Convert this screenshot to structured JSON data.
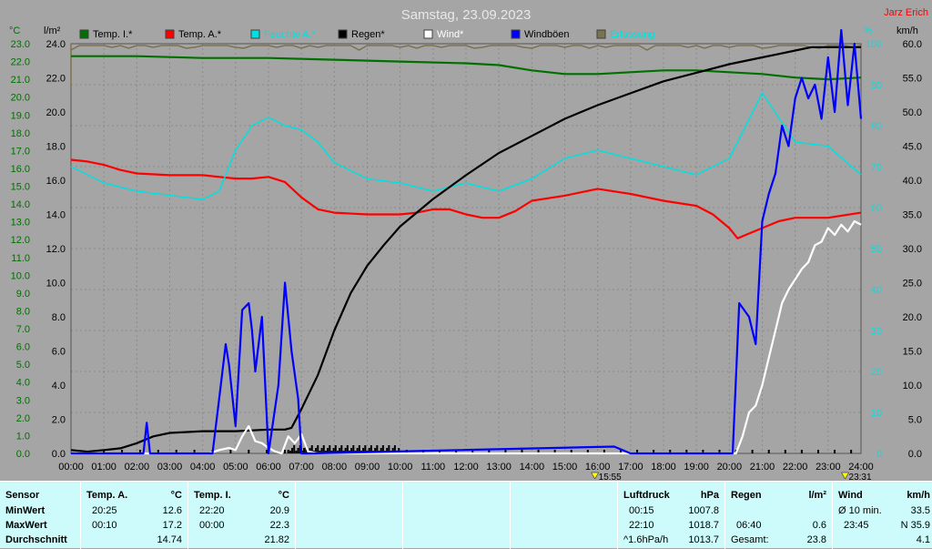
{
  "title": "Samstag, 23.09.2023",
  "author": "Jarz Erich",
  "units": {
    "temp": "°C",
    "rain": "l/m²",
    "hum": "%",
    "wind": "km/h"
  },
  "legend": [
    {
      "label": "Temp. I.*",
      "color": "#007000"
    },
    {
      "label": "Temp. A.*",
      "color": "#ff0000"
    },
    {
      "label": "Feuchte A.*",
      "color": "#00e0e0"
    },
    {
      "label": "Regen*",
      "color": "#000000"
    },
    {
      "label": "Wind*",
      "color": "#ffffff"
    },
    {
      "label": "Windböen",
      "color": "#0000ff"
    },
    {
      "label": "Erfassung",
      "color": "#7a7350"
    }
  ],
  "markers": {
    "left": "15:55",
    "right": "23:31"
  },
  "chart_data": {
    "type": "line",
    "x_ticks": [
      "00:00",
      "01:00",
      "02:00",
      "03:00",
      "04:00",
      "05:00",
      "06:00",
      "07:00",
      "08:00",
      "09:00",
      "10:00",
      "11:00",
      "12:00",
      "13:00",
      "14:00",
      "15:00",
      "16:00",
      "17:00",
      "18:00",
      "19:00",
      "20:00",
      "21:00",
      "22:00",
      "23:00",
      "24:00"
    ],
    "axes": {
      "temp_green": {
        "ticks": [
          "0.0",
          "1.0",
          "2.0",
          "3.0",
          "4.0",
          "5.0",
          "6.0",
          "7.0",
          "8.0",
          "9.0",
          "10.0",
          "11.0",
          "12.0",
          "13.0",
          "14.0",
          "15.0",
          "16.0",
          "17.0",
          "18.0",
          "19.0",
          "20.0",
          "21.0",
          "22.0",
          "23.0"
        ],
        "range": [
          0,
          23
        ]
      },
      "rain_black": {
        "ticks": [
          "0.0",
          "2.0",
          "4.0",
          "6.0",
          "8.0",
          "10.0",
          "12.0",
          "14.0",
          "16.0",
          "18.0",
          "20.0",
          "22.0",
          "24.0"
        ],
        "range": [
          0,
          24
        ]
      },
      "hum_cyan": {
        "ticks": [
          "0",
          "10",
          "20",
          "30",
          "40",
          "50",
          "60",
          "70",
          "80",
          "90",
          "100"
        ],
        "range": [
          0,
          100
        ]
      },
      "wind_black": {
        "ticks": [
          "0.0",
          "5.0",
          "10.0",
          "15.0",
          "20.0",
          "25.0",
          "30.0",
          "35.0",
          "40.0",
          "45.0",
          "50.0",
          "55.0",
          "60.0"
        ],
        "range": [
          0,
          60
        ]
      }
    },
    "series": [
      {
        "name": "Temp. I.*",
        "axis": "temp_green",
        "color": "#007000",
        "x": [
          0,
          2,
          4,
          6,
          8,
          10,
          12,
          13,
          14,
          15,
          16,
          17,
          18,
          19,
          20,
          21,
          22,
          23,
          24
        ],
        "y": [
          22.3,
          22.3,
          22.2,
          22.2,
          22.1,
          22.0,
          21.9,
          21.8,
          21.5,
          21.3,
          21.3,
          21.4,
          21.5,
          21.5,
          21.4,
          21.3,
          21.1,
          21.0,
          21.1
        ]
      },
      {
        "name": "Temp. A.*",
        "axis": "temp_red",
        "color": "#ff0000",
        "x": [
          0,
          0.5,
          1,
          1.5,
          2,
          3,
          4,
          4.5,
          5,
          5.5,
          6,
          6.5,
          7,
          7.5,
          8,
          9,
          10,
          10.5,
          11,
          11.5,
          12,
          12.5,
          13,
          13.5,
          14,
          15,
          16,
          17,
          18,
          19,
          19.5,
          20,
          20.25,
          20.5,
          21,
          21.5,
          22,
          23,
          24
        ],
        "y": [
          17.2,
          17.1,
          16.9,
          16.6,
          16.4,
          16.3,
          16.3,
          16.2,
          16.1,
          16.1,
          16.2,
          15.9,
          15.0,
          14.3,
          14.1,
          14.0,
          14.0,
          14.1,
          14.3,
          14.3,
          14.0,
          13.8,
          13.8,
          14.2,
          14.8,
          15.1,
          15.5,
          15.2,
          14.8,
          14.5,
          14.0,
          13.2,
          12.6,
          12.8,
          13.2,
          13.6,
          13.8,
          13.8,
          14.1
        ]
      },
      {
        "name": "Feuchte A.*",
        "axis": "hum_cyan",
        "color": "#00e0e0",
        "x": [
          0,
          1,
          2,
          3,
          4,
          4.5,
          5,
          5.5,
          6,
          6.5,
          7,
          7.5,
          8,
          9,
          10,
          11,
          12,
          13,
          14,
          15,
          16,
          17,
          18,
          19,
          20,
          20.5,
          21,
          21.5,
          22,
          23,
          24
        ],
        "y": [
          70,
          66,
          64,
          63,
          62,
          64,
          74,
          80,
          82,
          80,
          79,
          76,
          71,
          67,
          66,
          64,
          66,
          64,
          67,
          72,
          74,
          72,
          70,
          68,
          72,
          80,
          88,
          82,
          76,
          75,
          68
        ]
      },
      {
        "name": "Regen*",
        "axis": "rain_black",
        "color": "#000000",
        "x": [
          0,
          0.5,
          1,
          1.5,
          2,
          2.5,
          3,
          4,
          5,
          6,
          6.5,
          6.7,
          7,
          7.5,
          8,
          8.5,
          9,
          9.5,
          10,
          11,
          12,
          13,
          14,
          15,
          16,
          17,
          18,
          19,
          20,
          21,
          21.5,
          22,
          22.5,
          23,
          24
        ],
        "y": [
          0.2,
          0.1,
          0.2,
          0.3,
          0.6,
          1.0,
          1.2,
          1.3,
          1.3,
          1.4,
          1.4,
          1.5,
          2.6,
          4.6,
          7.2,
          9.4,
          11.0,
          12.2,
          13.3,
          14.9,
          16.3,
          17.6,
          18.6,
          19.6,
          20.4,
          21.1,
          21.8,
          22.3,
          22.8,
          23.2,
          23.4,
          23.6,
          23.8,
          23.8,
          23.8
        ]
      },
      {
        "name": "Wind*",
        "axis": "wind_black",
        "color": "#ffffff",
        "x": [
          0,
          4.2,
          4.5,
          4.8,
          5,
          5.2,
          5.4,
          5.6,
          5.8,
          6,
          6.2,
          6.4,
          6.6,
          6.8,
          7,
          7.2,
          7.5,
          20.2,
          20.4,
          20.6,
          20.8,
          21,
          21.2,
          21.4,
          21.6,
          21.8,
          22,
          22.2,
          22.4,
          22.6,
          22.8,
          23,
          23.2,
          23.4,
          23.6,
          23.8,
          24
        ],
        "y": [
          0,
          0,
          0.5,
          0.8,
          0.5,
          2.5,
          4.0,
          1.8,
          1.5,
          0.8,
          0.3,
          0,
          2.5,
          1.5,
          2.8,
          0.3,
          0,
          0,
          2.5,
          6,
          7,
          10,
          14,
          18,
          22,
          24,
          25.5,
          27,
          28,
          30.5,
          31,
          33,
          32,
          33.5,
          32.5,
          34,
          33.5
        ]
      },
      {
        "name": "Windböen",
        "axis": "wind_black",
        "color": "#0000ff",
        "x": [
          0,
          2.2,
          2.3,
          2.4,
          4.3,
          4.5,
          4.7,
          4.8,
          5,
          5.2,
          5.4,
          5.5,
          5.6,
          5.8,
          6,
          6.3,
          6.5,
          6.7,
          6.9,
          7,
          7.3,
          16.5,
          17,
          20.1,
          20.3,
          20.6,
          20.8,
          21,
          21.2,
          21.4,
          21.6,
          21.8,
          22,
          22.2,
          22.4,
          22.6,
          22.8,
          23,
          23.2,
          23.4,
          23.6,
          23.8,
          24
        ],
        "y": [
          0,
          0,
          4.5,
          0,
          0,
          8,
          16,
          13,
          4,
          21,
          22,
          18,
          12,
          20,
          0,
          10,
          25,
          15,
          8,
          0,
          0,
          1,
          0,
          0,
          22,
          20,
          16,
          34,
          38,
          41,
          48,
          45,
          52,
          55,
          52,
          54,
          49,
          58,
          50,
          62,
          51,
          60,
          49
        ]
      }
    ]
  },
  "stats": {
    "headers": {
      "sensor": "Sensor",
      "min": "MinWert",
      "max": "MaxWert",
      "avg": "Durchschnitt"
    },
    "temp_a": {
      "label": "Temp. A.",
      "unit": "°C",
      "min_time": "20:25",
      "min_val": "12.6",
      "max_time": "00:10",
      "max_val": "17.2",
      "avg": "14.74"
    },
    "temp_i": {
      "label": "Temp. I.",
      "unit": "°C",
      "min_time": "22:20",
      "min_val": "20.9",
      "max_time": "00:00",
      "max_val": "22.3",
      "avg": "21.82"
    },
    "pressure": {
      "label": "Luftdruck",
      "unit": "hPa",
      "min_time": "00:15",
      "min_val": "1007.8",
      "max_time": "22:10",
      "max_val": "1018.7",
      "trend": "^1.6hPa/h",
      "current": "1013.7"
    },
    "rain": {
      "label": "Regen",
      "unit": "l/m²",
      "max_time": "06:40",
      "max_val": "0.6",
      "total_label": "Gesamt:",
      "total": "23.8"
    },
    "wind": {
      "label": "Wind",
      "unit": "km/h",
      "avg_label": "Ø 10 min.",
      "avg_val": "33.5",
      "max_time": "23:45",
      "max_val": "N 35.9",
      "mean": "4.1"
    }
  }
}
